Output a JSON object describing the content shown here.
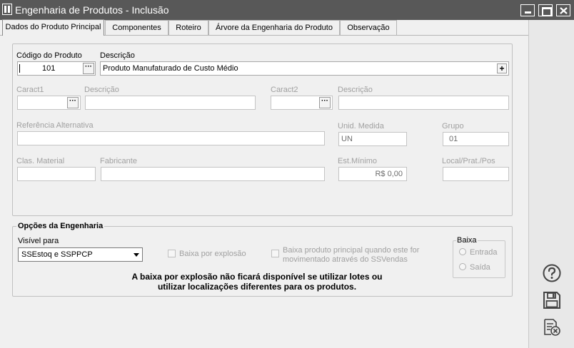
{
  "window": {
    "title": "Engenharia de Produtos - Inclusão"
  },
  "tabs": [
    {
      "label": "Dados do Produto Principal"
    },
    {
      "label": "Componentes"
    },
    {
      "label": "Roteiro"
    },
    {
      "label": "Árvore da Engenharia do Produto"
    },
    {
      "label": "Observação"
    }
  ],
  "product": {
    "codigo_label": "Código do Produto",
    "codigo_value": "101",
    "descricao_label": "Descrição",
    "descricao_value": "Produto Manufaturado de Custo Médio",
    "caract1_label": "Caract1",
    "caract1_desc_label": "Descrição",
    "caract2_label": "Caract2",
    "caract2_desc_label": "Descrição",
    "ref_alt_label": "Referência Alternativa",
    "unid_label": "Unid. Medida",
    "unid_value": "UN",
    "grupo_label": "Grupo",
    "grupo_value": "01",
    "clas_label": "Clas. Material",
    "fabricante_label": "Fabricante",
    "est_min_label": "Est.Mínimo",
    "est_min_value": "R$ 0,00",
    "local_label": "Local/Prat./Pos"
  },
  "engenharia": {
    "title": "Opções da Engenharia",
    "visivel_label": "Visível para",
    "visivel_value": "SSEstoq e SSPPCP",
    "baixa_explosao_label": "Baixa por explosão",
    "baixa_principal_label_1": "Baixa produto principal quando este for",
    "baixa_principal_label_2": "movimentado através do SSVendas",
    "baixa_group_title": "Baixa",
    "entrada_label": "Entrada",
    "saida_label": "Saída",
    "note_line1": "A baixa por explosão não ficará disponível  se utilizar lotes ou",
    "note_line2": "utilizar localizações diferentes para os produtos."
  },
  "sidebar": {
    "icons": [
      "help-icon",
      "save-icon",
      "cancel-document-icon"
    ]
  },
  "colors": {
    "titlebar": "#585858",
    "background": "#f0f0f0",
    "disabled_text": "#a0a0a0"
  }
}
